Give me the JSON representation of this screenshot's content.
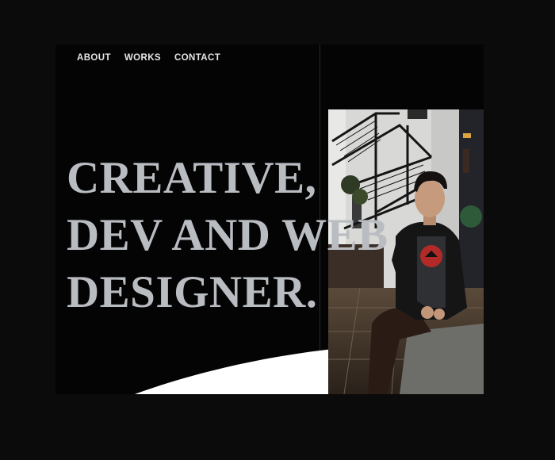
{
  "nav": {
    "items": [
      {
        "label": "ABOUT"
      },
      {
        "label": "WORKS"
      },
      {
        "label": "CONTACT"
      }
    ]
  },
  "hero": {
    "lines": [
      "CREATIVE,",
      "DEV AND WEB",
      "DESIGNER."
    ],
    "text_color": "#b9bcc1"
  },
  "colors": {
    "page_bg": "#0b0b0b",
    "frame_bg": "#040404",
    "wave": "#ffffff"
  }
}
